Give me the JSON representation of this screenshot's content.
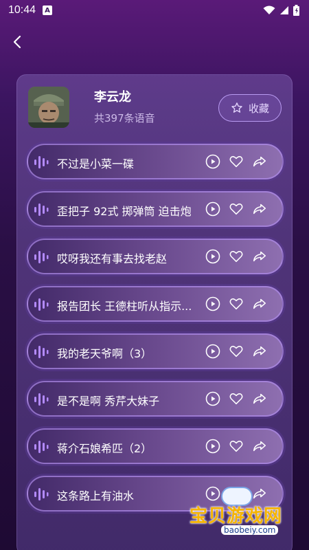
{
  "status": {
    "time": "10:44",
    "notif_badge": "A"
  },
  "header": {
    "back_icon": "chevron-left-icon"
  },
  "profile": {
    "name": "李云龙",
    "count": "共397条语音",
    "fav_label": "收藏"
  },
  "items": [
    {
      "text": "不过是小菜一碟"
    },
    {
      "text": "歪把子 92式 掷弹筒 迫击炮"
    },
    {
      "text": "哎呀我还有事去找老赵"
    },
    {
      "text": "报告团长 王德柱听从指示..."
    },
    {
      "text": "我的老天爷啊（3）"
    },
    {
      "text": "是不是啊  秀芹大妹子"
    },
    {
      "text": "蒋介石娘希匹（2）"
    },
    {
      "text": "这条路上有油水"
    }
  ],
  "watermark": {
    "title": "宝贝游戏网",
    "url": "baobeiy.com"
  },
  "colors": {
    "accent": "#b99bf2",
    "background": "#2a0f45",
    "watermark": "#f5b400"
  }
}
